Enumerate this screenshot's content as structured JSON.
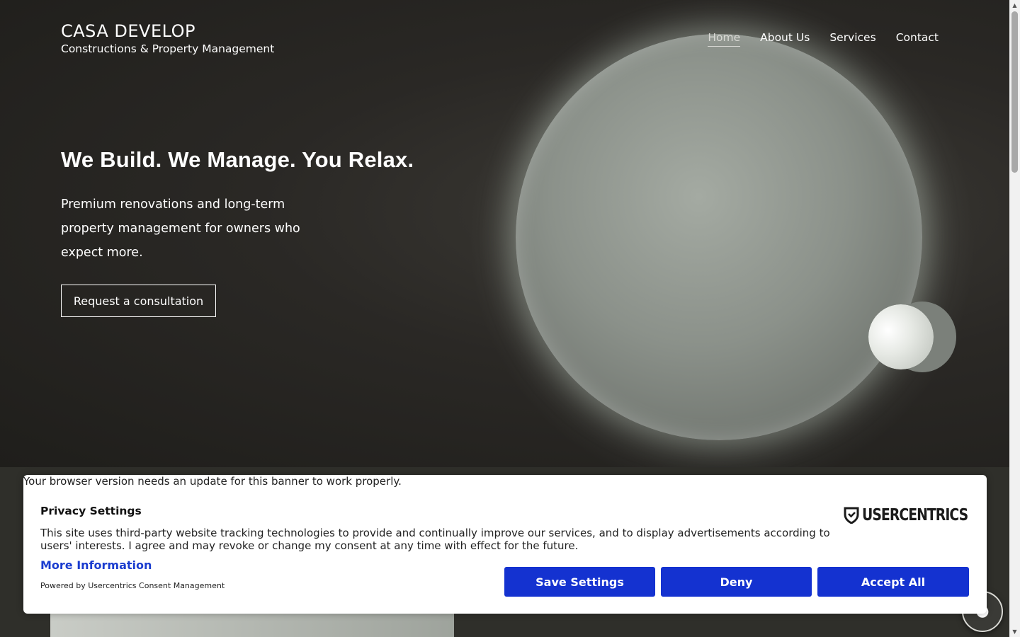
{
  "brand": {
    "name": "CASA DEVELOP",
    "tagline": "Constructions & Property Management"
  },
  "nav": {
    "items": [
      {
        "label": "Home",
        "active": true
      },
      {
        "label": "About Us",
        "active": false
      },
      {
        "label": "Services",
        "active": false
      },
      {
        "label": "Contact",
        "active": false
      }
    ]
  },
  "hero": {
    "headline": "We Build. We Manage. You Relax.",
    "subtext": "Premium renovations and long-term property management for owners who expect more.",
    "cta_label": "Request a consultation"
  },
  "consent": {
    "warning": "Your browser version needs an update for this banner to work properly.",
    "title": "Privacy Settings",
    "text": "This site uses third-party website tracking technologies to provide and continually improve our services, and to display advertisements according to users' interests. I agree and may revoke or change my consent at any time with effect for the future.",
    "more_info": "More Information",
    "powered_by": "Powered by Usercentrics Consent Management",
    "logo_text": "USERCENTRICS",
    "buttons": {
      "save": "Save Settings",
      "deny": "Deny",
      "accept": "Accept All"
    },
    "button_color": "#1432d0"
  },
  "icons": {
    "chat": "chat-icon",
    "shield": "usercentrics-shield-icon"
  }
}
